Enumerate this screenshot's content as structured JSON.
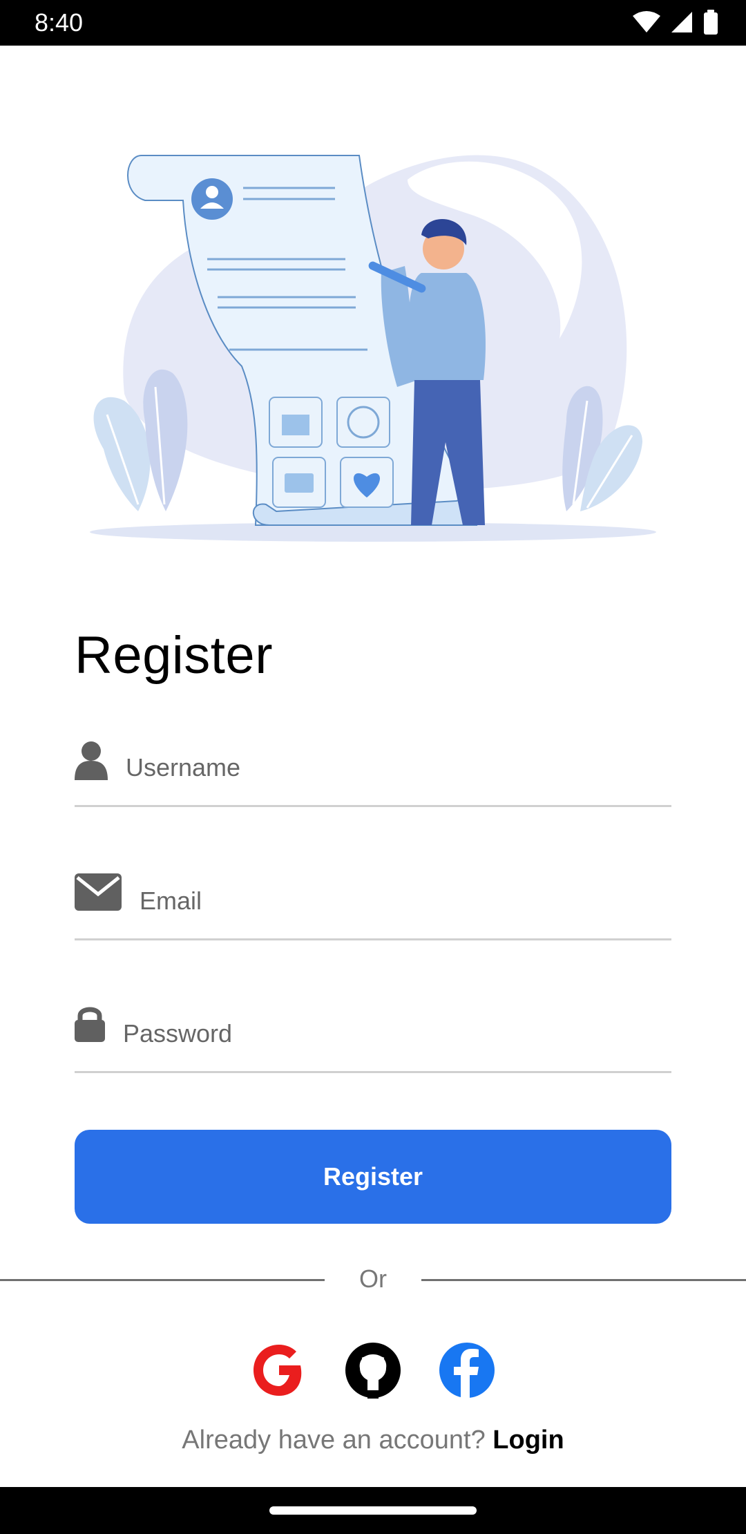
{
  "status_bar": {
    "time": "8:40"
  },
  "form": {
    "title": "Register",
    "username": {
      "placeholder": "Username"
    },
    "email": {
      "placeholder": "Email"
    },
    "password": {
      "placeholder": "Password"
    },
    "submit_label": "Register"
  },
  "divider": {
    "text": "Or"
  },
  "social": [
    "google-icon",
    "github-icon",
    "facebook-icon"
  ],
  "footer": {
    "prompt": "Already have an account?",
    "login_label": "Login"
  },
  "colors": {
    "accent": "#2a70e8",
    "google_red": "#ea1e1e",
    "facebook_blue": "#1877f2"
  }
}
